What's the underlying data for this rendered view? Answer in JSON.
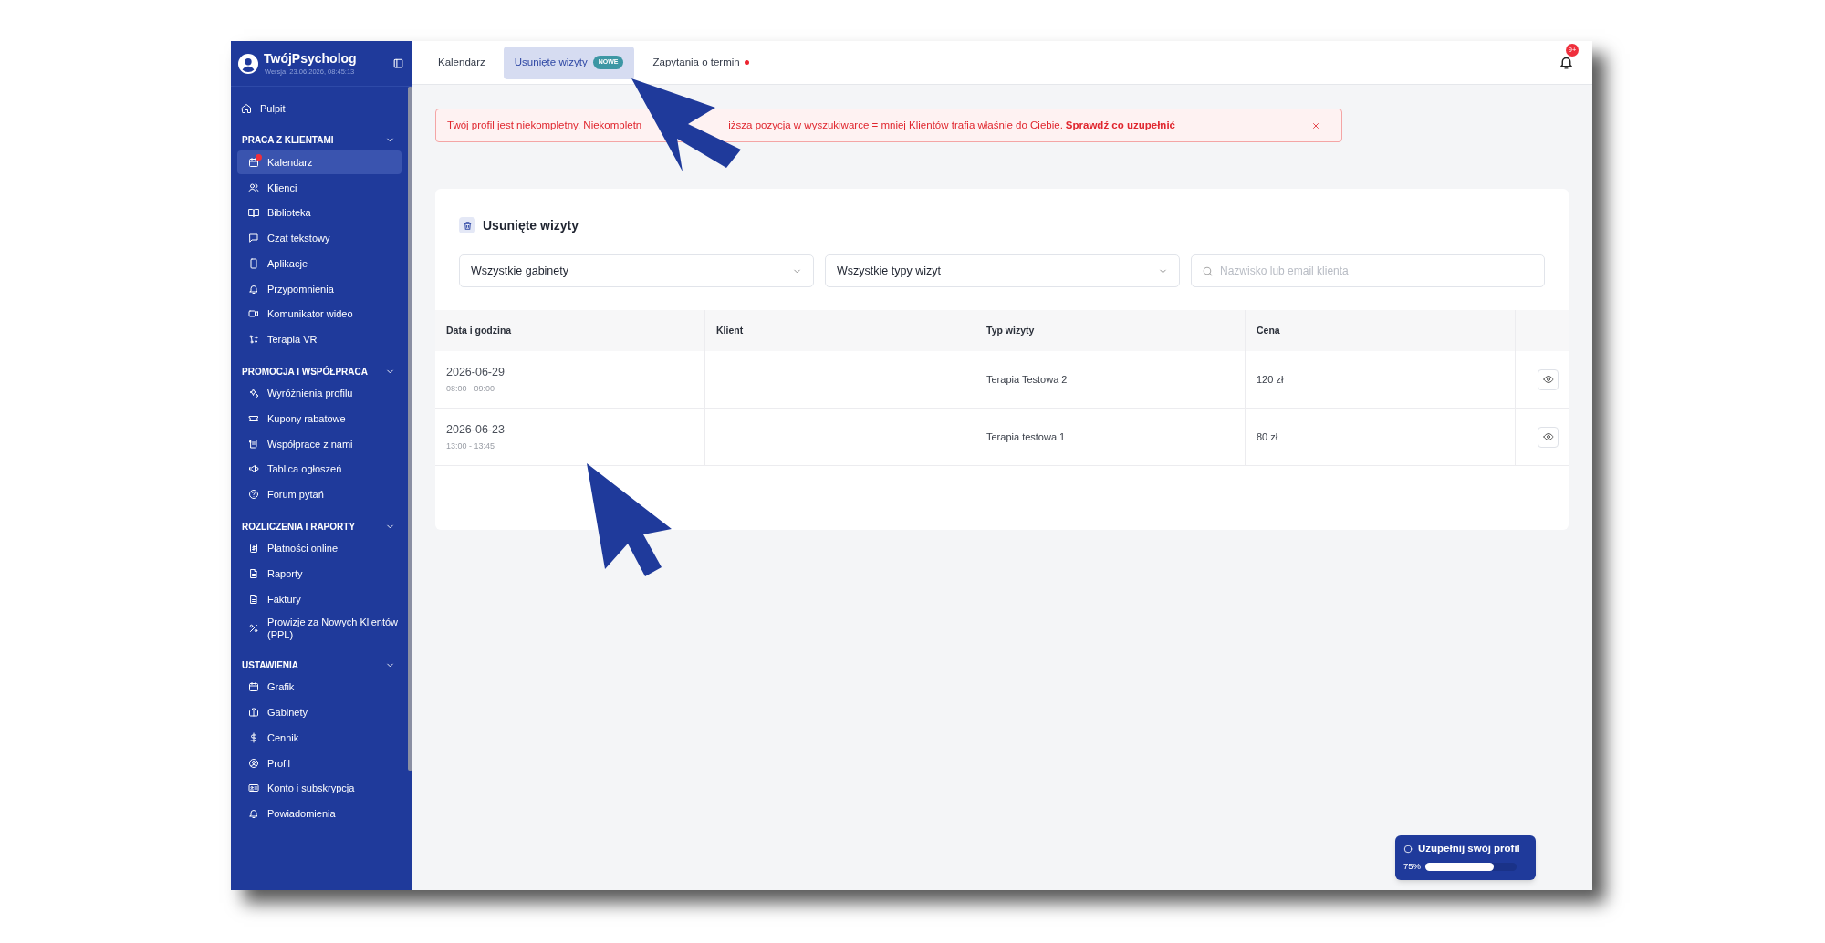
{
  "sidebar": {
    "brand": "TwójPsycholog",
    "version": "Wersja: 23.06.2026, 08:45:13",
    "top_items": [
      {
        "label": "Pulpit",
        "selected": false,
        "alert": false
      }
    ],
    "sections": [
      {
        "title": "PRACA Z KLIENTAMI",
        "expanded": true,
        "items": [
          {
            "label": "Kalendarz",
            "selected": true,
            "alert": true
          },
          {
            "label": "Klienci",
            "selected": false,
            "alert": false
          },
          {
            "label": "Biblioteka",
            "selected": false,
            "alert": false
          },
          {
            "label": "Czat tekstowy",
            "selected": false,
            "alert": false
          },
          {
            "label": "Aplikacje",
            "selected": false,
            "alert": false
          },
          {
            "label": "Przypomnienia",
            "selected": false,
            "alert": false
          },
          {
            "label": "Komunikator wideo",
            "selected": false,
            "alert": false
          },
          {
            "label": "Terapia VR",
            "selected": false,
            "alert": false
          }
        ]
      },
      {
        "title": "PROMOCJA I WSPÓŁPRACA",
        "expanded": true,
        "items": [
          {
            "label": "Wyróżnienia profilu",
            "selected": false,
            "alert": false
          },
          {
            "label": "Kupony rabatowe",
            "selected": false,
            "alert": false
          },
          {
            "label": "Współprace z nami",
            "selected": false,
            "alert": false
          },
          {
            "label": "Tablica ogłoszeń",
            "selected": false,
            "alert": false
          },
          {
            "label": "Forum pytań",
            "selected": false,
            "alert": false
          }
        ]
      },
      {
        "title": "ROZLICZENIA I RAPORTY",
        "expanded": true,
        "items": [
          {
            "label": "Płatności online",
            "selected": false,
            "alert": false
          },
          {
            "label": "Raporty",
            "selected": false,
            "alert": false
          },
          {
            "label": "Faktury",
            "selected": false,
            "alert": false
          },
          {
            "label": "Prowizje za Nowych Klientów (PPL)",
            "selected": false,
            "alert": false
          }
        ]
      },
      {
        "title": "USTAWIENIA",
        "expanded": true,
        "items": [
          {
            "label": "Grafik",
            "selected": false,
            "alert": false
          },
          {
            "label": "Gabinety",
            "selected": false,
            "alert": false
          },
          {
            "label": "Cennik",
            "selected": false,
            "alert": false
          },
          {
            "label": "Profil",
            "selected": false,
            "alert": false
          },
          {
            "label": "Konto i subskrypcja",
            "selected": false,
            "alert": false
          },
          {
            "label": "Powiadomienia",
            "selected": false,
            "alert": false
          }
        ]
      }
    ]
  },
  "tabs": [
    {
      "label": "Kalendarz",
      "selected": false,
      "dot": false
    },
    {
      "label": "Usunięte wizyty",
      "selected": true,
      "dot": false,
      "badge": "NOWE"
    },
    {
      "label": "Zapytania o termin",
      "selected": false,
      "dot": true
    }
  ],
  "notifications": {
    "badge": "9+"
  },
  "alert": {
    "text_parts": [
      "Twój profil jest niekompletny. Niekompletn",
      "iższa pozycja w wyszukiwarce = mniej Klientów trafia właśnie do Ciebie."
    ],
    "link": "Sprawdź co uzupełnić"
  },
  "card": {
    "title": "Usunięte wizyty",
    "filters": [
      {
        "value": "Wszystkie gabinety"
      },
      {
        "value": "Wszystkie typy wizyt"
      }
    ],
    "search": {
      "placeholder": "Nazwisko lub email klienta"
    },
    "table": {
      "columns": [
        "Data i godzina",
        "Klient",
        "Typ wizyty",
        "Cena"
      ],
      "rows": [
        {
          "date": "2026-06-29",
          "time": "08:00 - 09:00",
          "type": "Terapia Testowa 2",
          "price": "120 zł"
        },
        {
          "date": "2026-06-23",
          "time": "13:00 - 13:45",
          "type": "Terapia testowa 1",
          "price": "80 zł"
        }
      ]
    }
  },
  "profile_progress": {
    "title": "Uzupełnij swój profil",
    "reading": "75%",
    "level": 0.75
  },
  "annotations": [
    {
      "kind": "arrow"
    },
    {
      "kind": "arrow"
    }
  ]
}
